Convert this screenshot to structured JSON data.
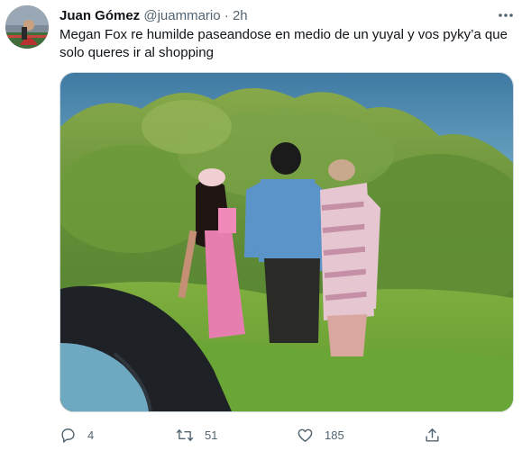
{
  "tweet": {
    "author": {
      "name": "Juan Gómez",
      "handle": "@juammario",
      "separator": "·",
      "time": "2h"
    },
    "text_line1": "Megan Fox re humilde paseandose en medio de un yuyal y vos pyky’a que",
    "text_line2": "solo queres ir al shopping",
    "more_icon": "more-horizontal-icon",
    "actions": {
      "replies": "4",
      "retweets": "51",
      "likes": "185"
    }
  },
  "colors": {
    "text": "#0f1419",
    "secondary": "#536471",
    "border": "#cfd9de",
    "water": "#4f86a9",
    "foliage": "#6f9a3e"
  }
}
